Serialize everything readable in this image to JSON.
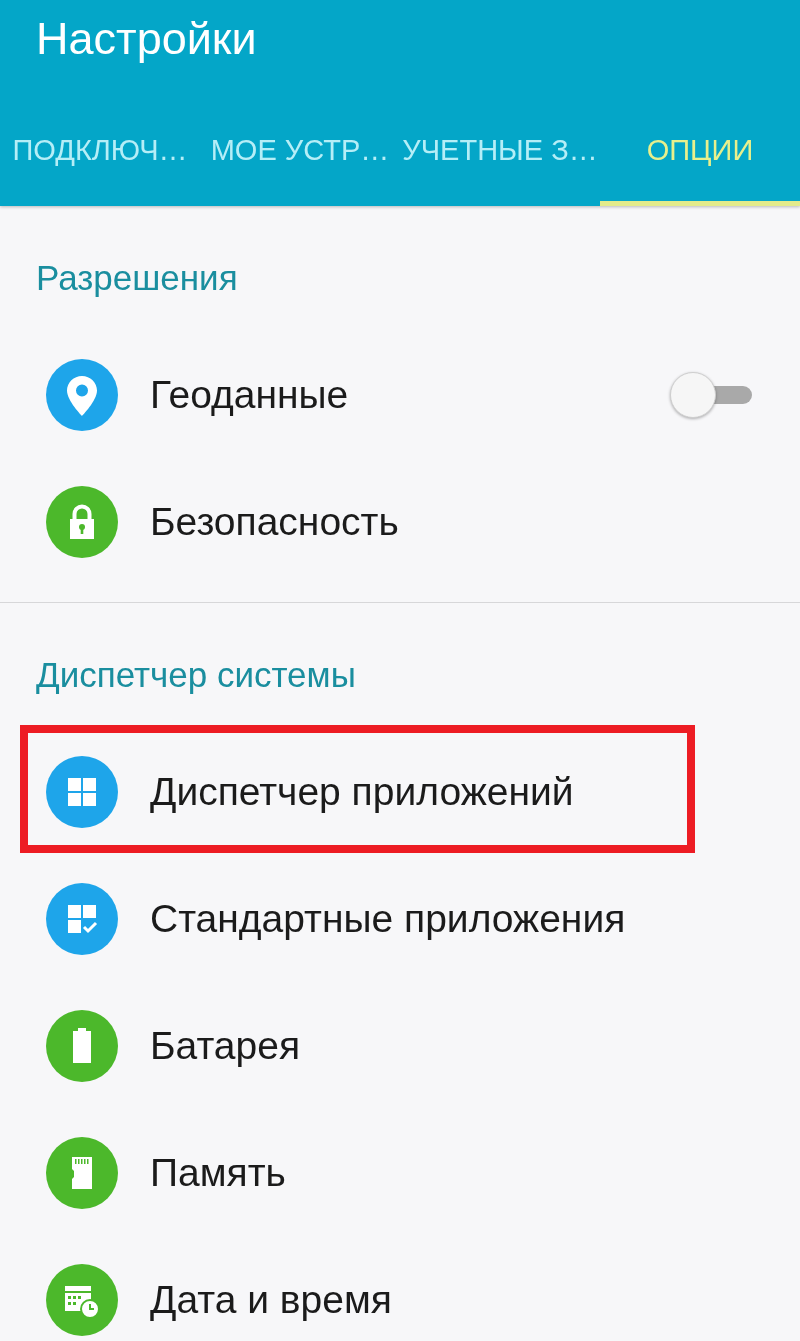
{
  "window": {
    "title": "Настройки"
  },
  "tabs": [
    {
      "label": "ПОДКЛЮЧ…",
      "selected": false
    },
    {
      "label": "МОЕ УСТР…",
      "selected": false
    },
    {
      "label": "УЧЕТНЫЕ З…",
      "selected": false
    },
    {
      "label": "ОПЦИИ",
      "selected": true
    }
  ],
  "sections": [
    {
      "heading": "Разрешения",
      "items": [
        {
          "label": "Геоданные",
          "color": "#1ea5ea",
          "kind": "toggle",
          "on": false,
          "highlighted": false
        },
        {
          "label": "Безопасность",
          "color": "#4cb82b",
          "kind": "link",
          "highlighted": false
        }
      ]
    },
    {
      "heading": "Диспетчер системы",
      "items": [
        {
          "label": "Диспетчер приложений",
          "color": "#1ea5ea",
          "kind": "link",
          "highlighted": true
        },
        {
          "label": "Стандартные приложения",
          "color": "#1ea5ea",
          "kind": "link",
          "highlighted": false
        },
        {
          "label": "Батарея",
          "color": "#4cb82b",
          "kind": "link",
          "highlighted": false
        },
        {
          "label": "Память",
          "color": "#4cb82b",
          "kind": "link",
          "highlighted": false
        },
        {
          "label": "Дата и время",
          "color": "#4cb82b",
          "kind": "link",
          "highlighted": false
        }
      ]
    }
  ]
}
